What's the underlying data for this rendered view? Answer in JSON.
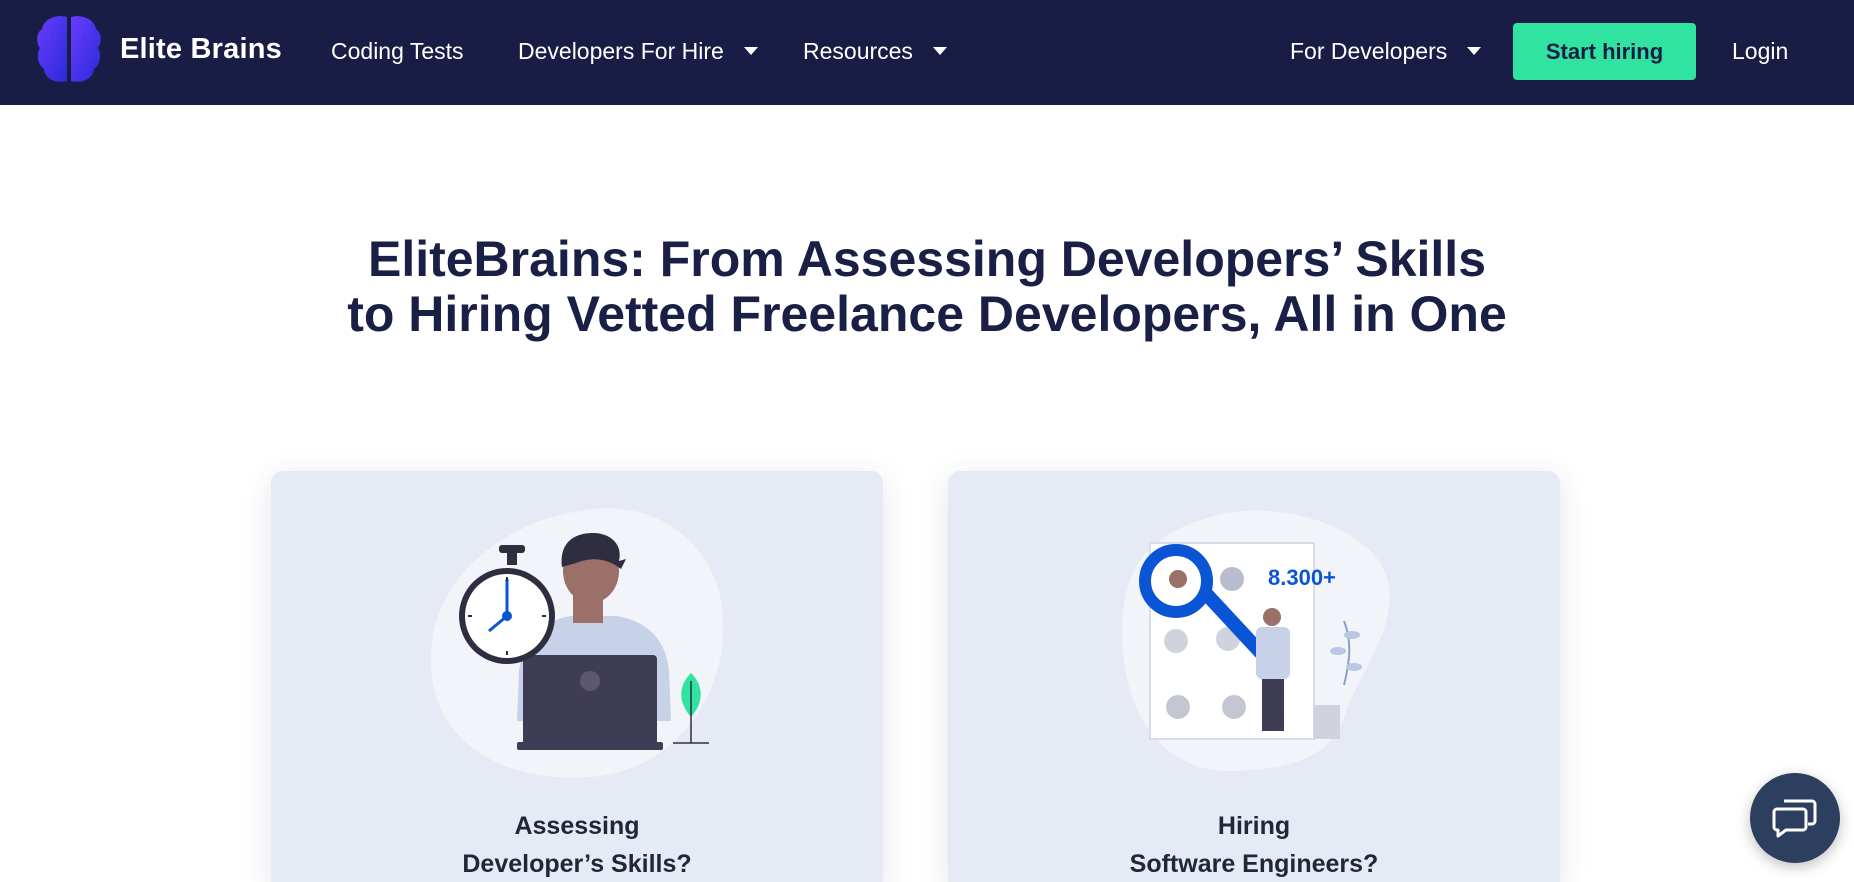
{
  "brand": {
    "name": "Elite Brains"
  },
  "nav": {
    "coding_tests": "Coding Tests",
    "developers_for_hire": "Developers For Hire",
    "resources": "Resources",
    "for_developers": "For Developers",
    "start_hiring": "Start hiring",
    "login": "Login"
  },
  "hero": {
    "line1": "EliteBrains: From Assessing Developers’ Skills",
    "line2": "to Hiring Vetted Freelance Developers, All in One"
  },
  "cards": [
    {
      "line1": "Assessing",
      "line2": "Developer’s Skills?"
    },
    {
      "line1": "Hiring",
      "line2": "Software Engineers?",
      "badge": "8.300+"
    }
  ],
  "colors": {
    "nav_bg": "#191d45",
    "accent_green": "#30e3a0",
    "card_bg": "#e6eaf4",
    "illustration_blue": "#0a55d6"
  },
  "icons": [
    "brain-logo-icon",
    "caret-down-icon",
    "chat-icon"
  ]
}
